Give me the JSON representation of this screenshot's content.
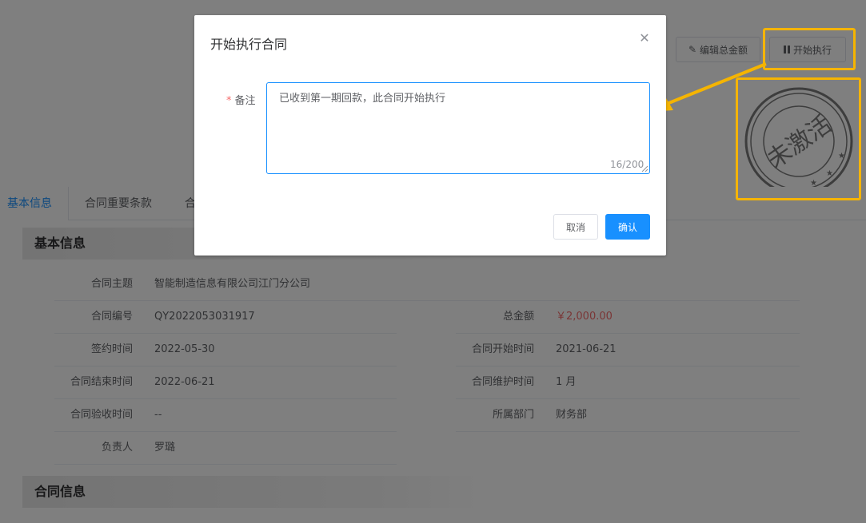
{
  "header": {
    "edit_amount_label": "编辑总金额",
    "start_label": "开始执行",
    "pencil_icon": "pencil-icon",
    "pause_icon": "pause-icon"
  },
  "stamp": {
    "text": "未激活",
    "color": "#7a7a7a"
  },
  "tabs": [
    {
      "label": "基本信息",
      "active": true
    },
    {
      "label": "合同重要条款",
      "active": false
    },
    {
      "label": "合",
      "active": false
    }
  ],
  "sections": {
    "basic_title": "基本信息",
    "contract_title": "合同信息"
  },
  "details": {
    "subject": {
      "label": "合同主题",
      "value": "智能制造信息有限公司江门分公司"
    },
    "number": {
      "label": "合同编号",
      "value": "QY2022053031917"
    },
    "total": {
      "label": "总金额",
      "value": "￥2,000.00"
    },
    "sign_time": {
      "label": "签约时间",
      "value": "2022-05-30"
    },
    "start_time": {
      "label": "合同开始时间",
      "value": "2021-06-21"
    },
    "end_time": {
      "label": "合同结束时间",
      "value": "2022-06-21"
    },
    "maintain_time": {
      "label": "合同维护时间",
      "value": "1 月"
    },
    "accept_time": {
      "label": "合同验收时间",
      "value": "--"
    },
    "department": {
      "label": "所属部门",
      "value": "财务部"
    },
    "owner": {
      "label": "负责人",
      "value": "罗璐"
    }
  },
  "dialog": {
    "title": "开始执行合同",
    "close_icon": "close-icon",
    "field_label": "备注",
    "required_mark": "*",
    "remark_value": "已收到第一期回款，此合同开始执行",
    "counter": "16/200",
    "cancel_label": "取消",
    "confirm_label": "确认"
  },
  "colors": {
    "primary": "#1890ff",
    "highlight": "#f5b400",
    "amount": "#f56c6c"
  }
}
